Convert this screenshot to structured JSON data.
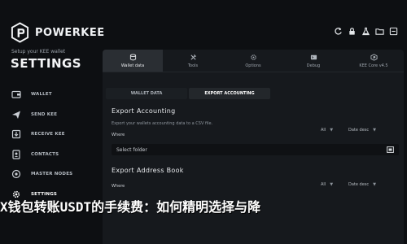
{
  "brand": {
    "name": "POWERKEE"
  },
  "sidebar": {
    "setup_line": "Setup your KEE wallet",
    "title": "SETTINGS",
    "items": [
      {
        "label": "WALLET",
        "icon": "wallet-icon"
      },
      {
        "label": "SEND KEE",
        "icon": "send-icon"
      },
      {
        "label": "RECEIVE KEE",
        "icon": "receive-icon"
      },
      {
        "label": "CONTACTS",
        "icon": "contacts-icon"
      },
      {
        "label": "MASTER NODES",
        "icon": "master-nodes-icon"
      },
      {
        "label": "SETTINGS",
        "icon": "gear-icon"
      }
    ]
  },
  "top_icons": [
    "refresh-icon",
    "lock-icon",
    "flask-icon",
    "folder-icon",
    "minimize-icon"
  ],
  "tabs": [
    {
      "label": "Wallet data",
      "icon": "database-icon"
    },
    {
      "label": "Tools",
      "icon": "tools-icon"
    },
    {
      "label": "Options",
      "icon": "options-icon"
    },
    {
      "label": "Debug",
      "icon": "debug-icon"
    },
    {
      "label": "KEE Core v4.5",
      "icon": "kee-core-icon"
    }
  ],
  "subtabs": [
    "WALLET DATA",
    "EXPORT ACCOUNTING"
  ],
  "export_accounting": {
    "title": "Export Accounting",
    "description": "Export your wallets accounting data to a CSV file.",
    "where_label": "Where",
    "filter_all": "All",
    "filter_date": "Date desc",
    "select_placeholder": "Select folder"
  },
  "export_address_book": {
    "title": "Export Address Book",
    "where_label": "Where",
    "filter_all": "All",
    "filter_date": "Date desc"
  },
  "caption": "X钱包转账USDT的手续费：如何精明选择与降"
}
